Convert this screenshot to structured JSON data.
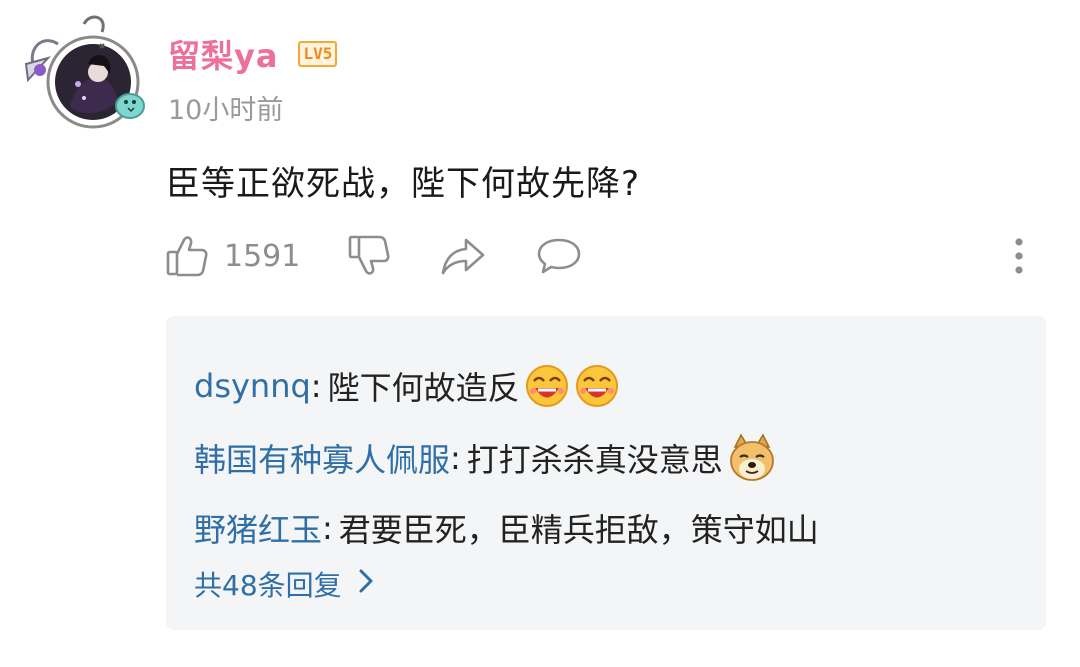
{
  "comment": {
    "username": "留梨ya",
    "level_badge": "LV5",
    "timestamp": "10小时前",
    "text": "臣等正欲死战，陛下何故先降?",
    "like_count": "1591",
    "icons": {
      "like": "thumbs-up-icon",
      "dislike": "thumbs-down-icon",
      "share": "share-icon",
      "reply": "comment-bubble-icon",
      "more": "more-vertical-icon"
    }
  },
  "replies": [
    {
      "name": "dsynnq",
      "colon": ":",
      "text": "陛下何故造反",
      "emojis": [
        "grinning-laugh-emoji",
        "grinning-laugh-emoji"
      ]
    },
    {
      "name": "韩国有种寡人佩服",
      "colon": ":",
      "text": "打打杀杀真没意思",
      "emojis": [
        "doge-emoji"
      ]
    },
    {
      "name": "野猪红玉",
      "colon": ":",
      "text": "君要臣死，臣精兵拒敌，策守如山",
      "emojis": []
    }
  ],
  "more_replies_label": "共48条回复",
  "colors": {
    "username": "#ed6f9b",
    "reply_name": "#2f6fa6",
    "badge": "#f08a1c",
    "panel_bg": "#f4f5f7"
  }
}
